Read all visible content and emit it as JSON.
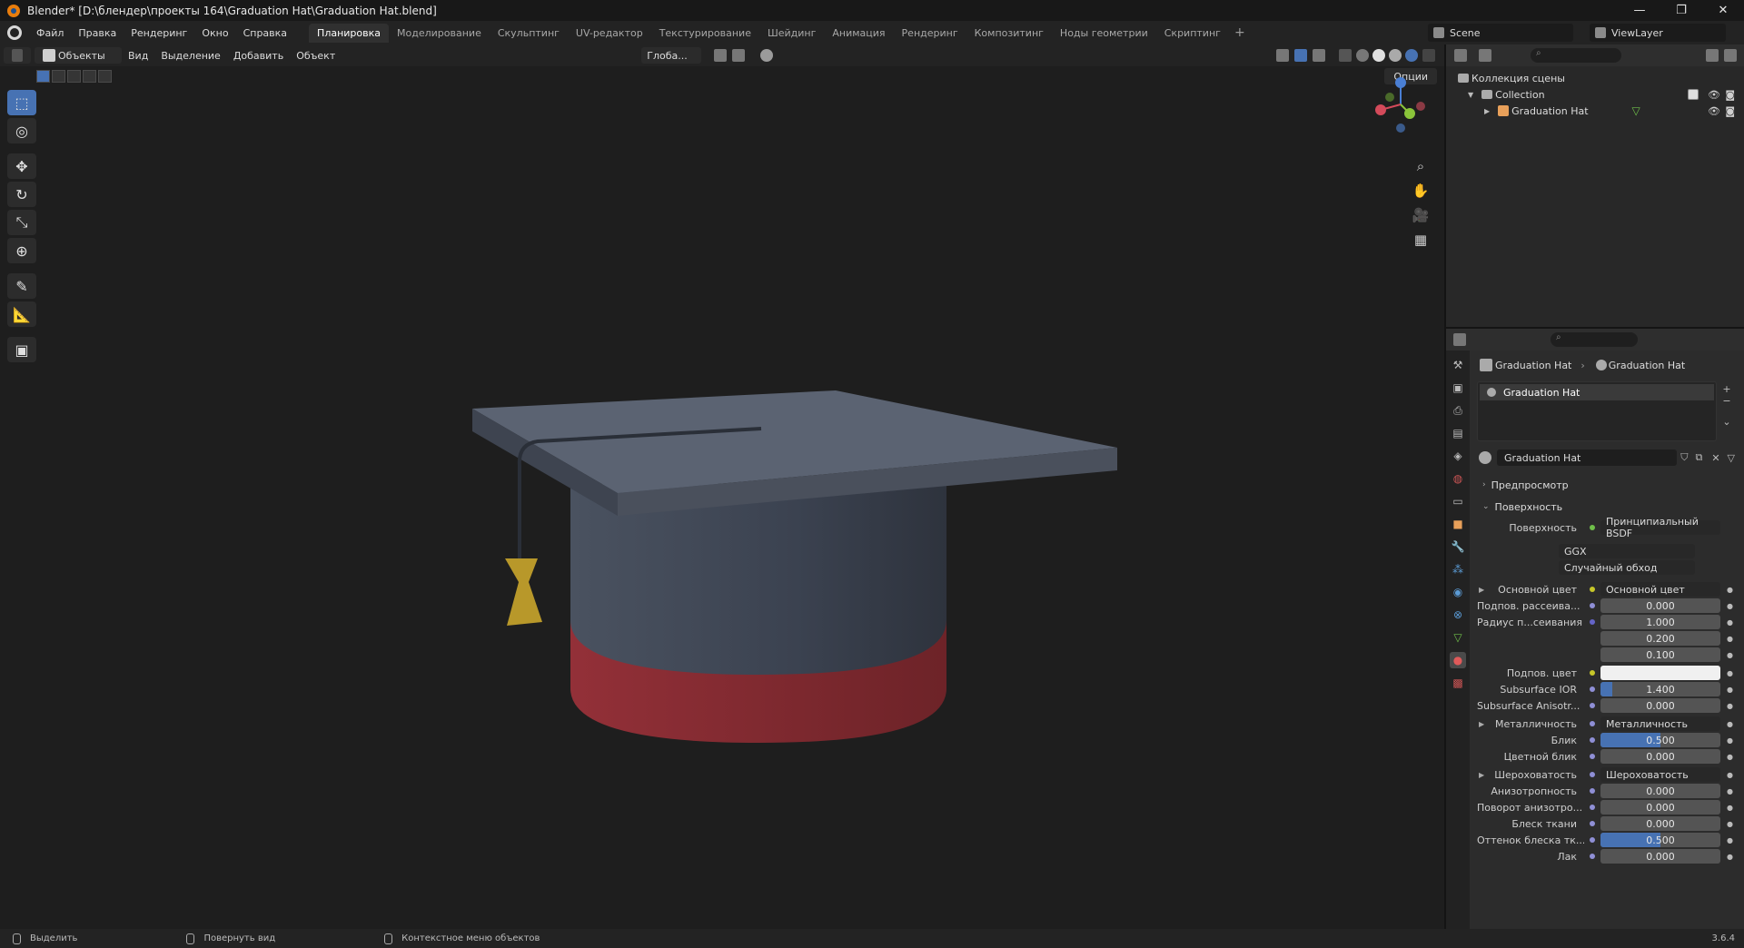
{
  "window": {
    "title": "Blender* [D:\\блендер\\проекты 164\\Graduation Hat\\Graduation Hat.blend]",
    "minimize": "—",
    "maximize": "❐",
    "close": "✕"
  },
  "menu": {
    "items": [
      "Файл",
      "Правка",
      "Рендеринг",
      "Окно",
      "Справка"
    ]
  },
  "workspaces": [
    "Планировка",
    "Моделирование",
    "Скульптинг",
    "UV-редактор",
    "Текстурирование",
    "Шейдинг",
    "Анимация",
    "Рендеринг",
    "Композитинг",
    "Ноды геометрии",
    "Скриптинг"
  ],
  "workspace_add": "+",
  "scene": {
    "name": "Scene",
    "view_layer": "ViewLayer"
  },
  "viewport_header": {
    "mode": "Объекты",
    "menus": [
      "Вид",
      "Выделение",
      "Добавить",
      "Объект"
    ],
    "transform_orientation": "Глоба...",
    "options": "Опции"
  },
  "tools": [
    "select-box",
    "cursor",
    "move",
    "rotate",
    "scale",
    "transform",
    "annotate",
    "measure",
    "add-cube"
  ],
  "outliner": {
    "root": "Коллекция сцены",
    "collection": "Collection",
    "object": "Graduation Hat"
  },
  "properties": {
    "breadcrumb": [
      "Graduation Hat",
      "Graduation Hat"
    ],
    "slot": "Graduation Hat",
    "material_name": "Graduation Hat",
    "panels": {
      "preview": "Предпросмотр",
      "surface": "Поверхность"
    },
    "surface_label": "Поверхность",
    "surface_shader": "Принципиальный BSDF",
    "distribution": "GGX",
    "subsurface_method": "Случайный обход",
    "rows": [
      {
        "label": "Основной цвет",
        "type": "link",
        "value": "Основной цвет",
        "dot": "#c7c729"
      },
      {
        "label": "Подпов. рассеива...",
        "type": "num",
        "value": "0.000",
        "dot": "#8f8fd6",
        "fill": 0
      },
      {
        "label": "Радиус п...сеивания",
        "type": "num",
        "value": "1.000",
        "dot": "#6464c8",
        "fill": 0
      },
      {
        "label": "",
        "type": "num",
        "value": "0.200",
        "dot": "",
        "fill": 0
      },
      {
        "label": "",
        "type": "num",
        "value": "0.100",
        "dot": "",
        "fill": 0
      },
      {
        "label": "Подпов. цвет",
        "type": "color",
        "value": "",
        "dot": "#c7c729",
        "color": "#f0f0f0"
      },
      {
        "label": "Subsurface IOR",
        "type": "num",
        "value": "1.400",
        "dot": "#8f8fd6",
        "fill": 0.1
      },
      {
        "label": "Subsurface Anisotr...",
        "type": "num",
        "value": "0.000",
        "dot": "#8f8fd6",
        "fill": 0
      },
      {
        "label": "Металличность",
        "type": "link",
        "value": "Металличность",
        "dot": "#8f8fd6"
      },
      {
        "label": "Блик",
        "type": "num",
        "value": "0.500",
        "dot": "#8f8fd6",
        "fill": 0.5
      },
      {
        "label": "Цветной блик",
        "type": "num",
        "value": "0.000",
        "dot": "#8f8fd6",
        "fill": 0
      },
      {
        "label": "Шероховатость",
        "type": "link",
        "value": "Шероховатость",
        "dot": "#8f8fd6"
      },
      {
        "label": "Анизотропность",
        "type": "num",
        "value": "0.000",
        "dot": "#8f8fd6",
        "fill": 0
      },
      {
        "label": "Поворот анизотро...",
        "type": "num",
        "value": "0.000",
        "dot": "#8f8fd6",
        "fill": 0
      },
      {
        "label": "Блеск ткани",
        "type": "num",
        "value": "0.000",
        "dot": "#8f8fd6",
        "fill": 0
      },
      {
        "label": "Оттенок блеска тк...",
        "type": "num",
        "value": "0.500",
        "dot": "#8f8fd6",
        "fill": 0.5
      },
      {
        "label": "Лак",
        "type": "num",
        "value": "0.000",
        "dot": "#8f8fd6",
        "fill": 0
      }
    ]
  },
  "statusbar": {
    "select": "Выделить",
    "rotate": "Повернуть вид",
    "context": "Контекстное меню объектов",
    "version": "3.6.4"
  },
  "colors": {
    "accent": "#4772b3",
    "brand": "#e87d0d",
    "hat_top": "#5a6270",
    "band": "#8a2e30",
    "tassel": "#c4a42c"
  }
}
